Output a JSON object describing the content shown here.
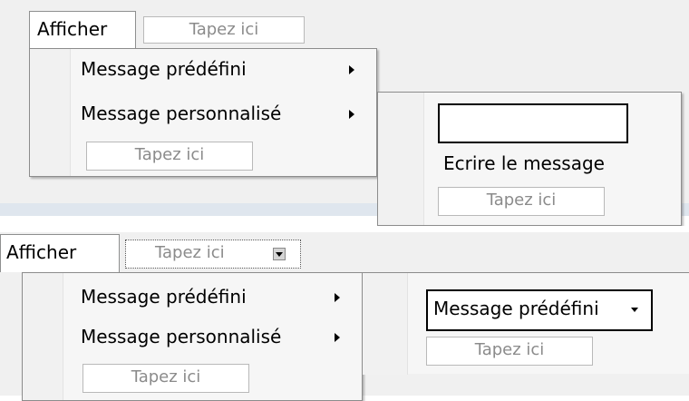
{
  "top": {
    "menu_label": "Afficher",
    "typehere_top": "Tapez ici",
    "items": [
      {
        "label": "Message prédéfini"
      },
      {
        "label": "Message personnalisé"
      }
    ],
    "typehere_menu": "Tapez ici",
    "submenu": {
      "textbox_value": "",
      "item_label": "Ecrire le message",
      "typehere": "Tapez ici"
    }
  },
  "bottom": {
    "menu_label": "Afficher",
    "typehere_top": "Tapez ici",
    "items": [
      {
        "label": "Message prédéfini"
      },
      {
        "label": "Message personnalisé"
      }
    ],
    "typehere_menu": "Tapez ici",
    "submenu": {
      "combo_value": "Message prédéfini",
      "typehere": "Tapez ici"
    }
  }
}
